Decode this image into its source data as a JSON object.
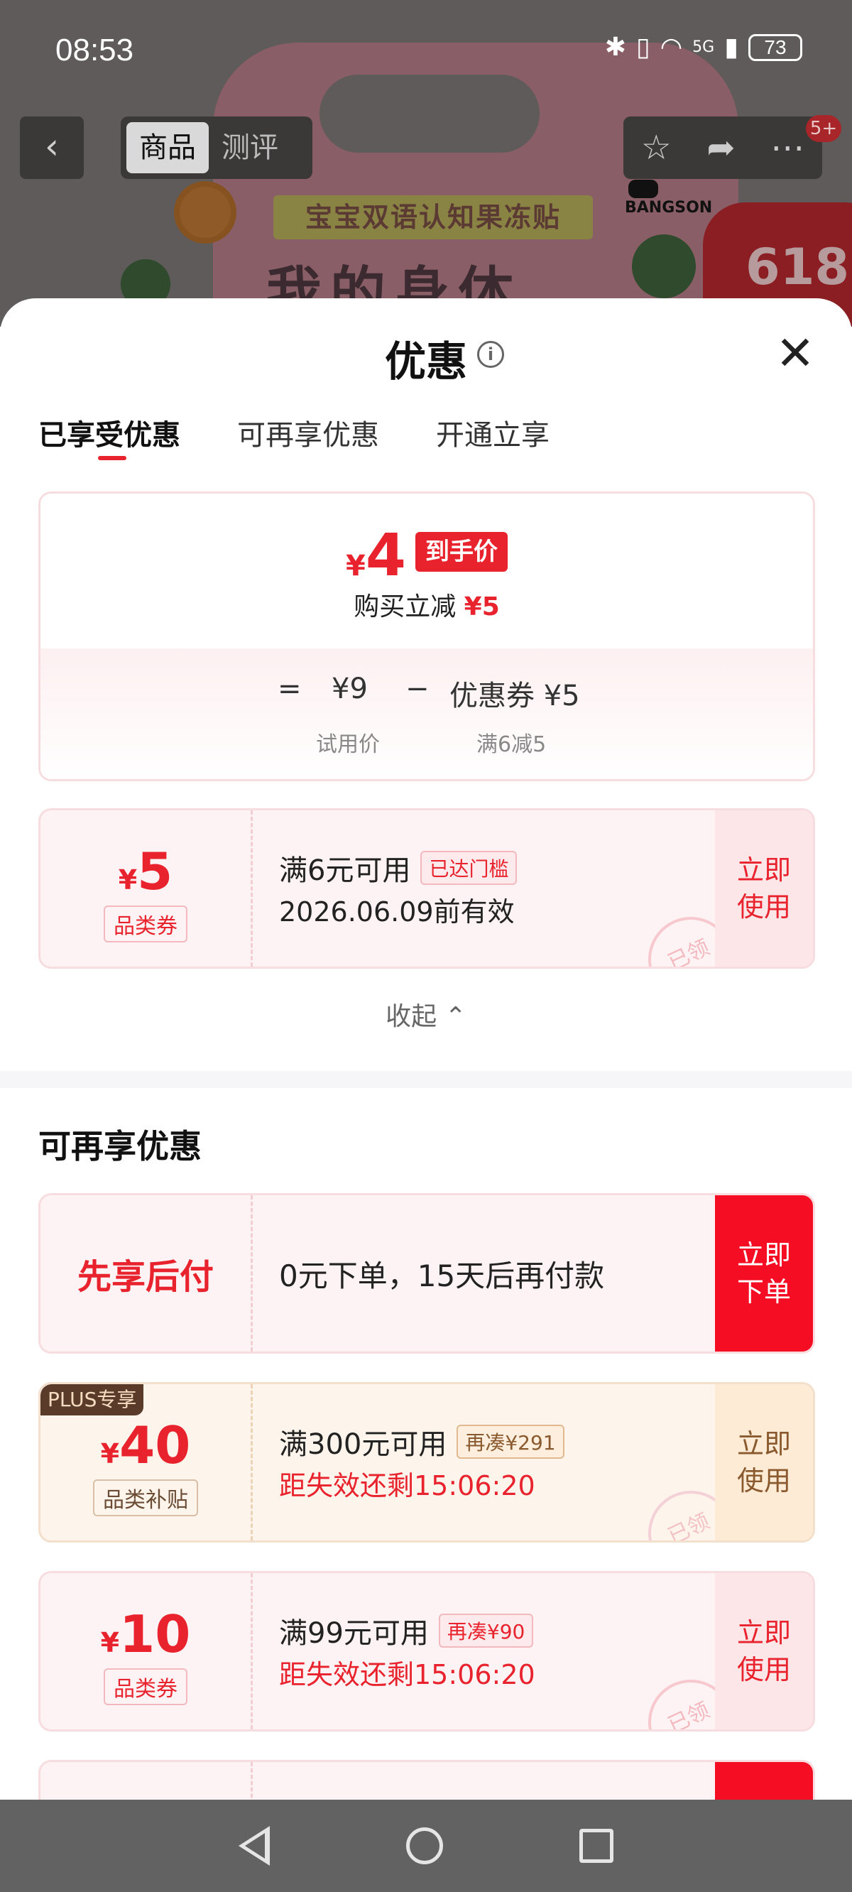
{
  "status": {
    "time": "08:53",
    "battery": "73",
    "network": "5G"
  },
  "product_bg": {
    "banner": "宝宝双语认知果冻贴",
    "title": "我的身体",
    "brand": "BANGSON",
    "sale": "618"
  },
  "topnav": {
    "tabs": [
      {
        "label": "商品"
      },
      {
        "label": "测评"
      }
    ],
    "badge": "5+"
  },
  "sheet": {
    "title": "优惠",
    "tabs": [
      {
        "label": "已享受优惠"
      },
      {
        "label": "可再享优惠"
      },
      {
        "label": "开通立享"
      }
    ]
  },
  "price": {
    "yen": "¥",
    "amount": "4",
    "tag": "到手价",
    "sub_prefix": "购买立减",
    "sub_amount": "¥5",
    "eq": "=",
    "trial_price": "¥9",
    "minus": "−",
    "coupon_label": "优惠券 ¥5",
    "trial_label": "试用价",
    "rule_label": "满6减5"
  },
  "applied_coupon": {
    "yen": "¥",
    "amount": "5",
    "type": "品类券",
    "condition": "满6元可用",
    "chip": "已达门槛",
    "validity": "2026.06.09前有效",
    "action": "立即使用",
    "stamp": "已领"
  },
  "collapse_label": "收起",
  "more_section": {
    "title": "可再享优惠",
    "pay_later": {
      "label": "先享后付",
      "desc": "0元下单，15天后再付款",
      "action": "立即下单"
    },
    "coupons": [
      {
        "badge": "PLUS专享",
        "yen": "¥",
        "amount": "40",
        "type": "品类补贴",
        "condition": "满300元可用",
        "chip": "再凑¥291",
        "countdown": "距失效还剩15:06:20",
        "action": "立即使用",
        "stamp": "已领"
      },
      {
        "yen": "¥",
        "amount": "10",
        "type": "品类券",
        "condition": "满99元可用",
        "chip": "再凑¥90",
        "countdown": "距失效还剩15:06:20",
        "action": "立即使用",
        "stamp": "已领"
      }
    ]
  },
  "colors": {
    "accent": "#e8232d",
    "plus": "#5a3b2a"
  }
}
